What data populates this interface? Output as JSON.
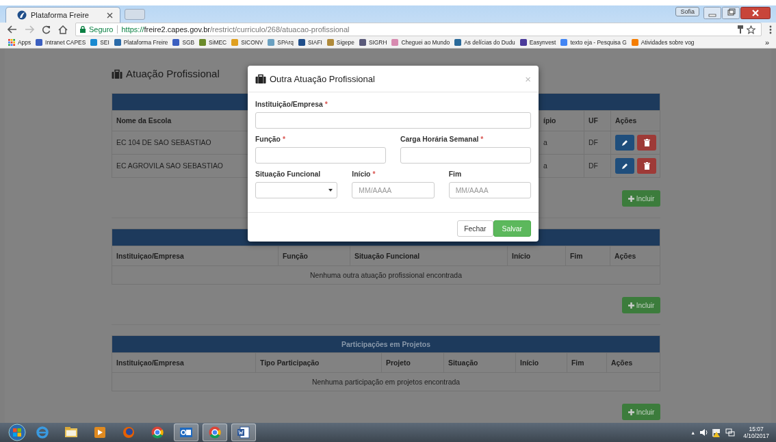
{
  "browser": {
    "tabs": [
      {
        "title": "Plataforma Freire",
        "selected": true
      }
    ],
    "user_button": "Sofia",
    "address": {
      "security": "Seguro",
      "scheme": "https://",
      "host": "freire2.capes.gov.br",
      "path": "/restrict/curriculo/268/atuacao-profissional"
    },
    "apps_label": "Apps",
    "bookmarks": [
      {
        "label": "Intranet CAPES",
        "color": "#3b5fc0"
      },
      {
        "label": "SEI",
        "color": "#1a8ad0"
      },
      {
        "label": "Plataforma Freire",
        "color": "#2a6aa8"
      },
      {
        "label": "SGB",
        "color": "#3b5fc0"
      },
      {
        "label": "SiMEC",
        "color": "#6a8a2a"
      },
      {
        "label": "SICONV",
        "color": "#e0a020"
      },
      {
        "label": "SPArq",
        "color": "#6aa0c0"
      },
      {
        "label": "SIAFI",
        "color": "#1f4e8a"
      },
      {
        "label": "Sigepe",
        "color": "#b08a3a"
      },
      {
        "label": "SIGRH",
        "color": "#5a5a7a"
      },
      {
        "label": "Cheguei ao Mundo",
        "color": "#d88ab0"
      },
      {
        "label": "As delícias do Dudu",
        "color": "#2a6a9a"
      },
      {
        "label": "Easynvest",
        "color": "#4a3a9a"
      },
      {
        "label": "texto eja - Pesquisa G",
        "color": "#4285f4"
      },
      {
        "label": "Atividades sobre vog",
        "color": "#f57d00"
      }
    ],
    "more": "»"
  },
  "page": {
    "heading": "Atuação Profissional",
    "sections": [
      {
        "columns": [
          "Nome da Escola",
          "ípio",
          "UF",
          "Ações"
        ],
        "rows": [
          {
            "cells": [
              "EC 104 DE SAO SEBASTIAO",
              "a",
              "DF"
            ],
            "actions": [
              {
                "kind": "edit"
              },
              {
                "kind": "delete"
              }
            ]
          },
          {
            "cells": [
              "EC AGROVILA SAO SEBASTIAO",
              "a",
              "DF"
            ],
            "actions": [
              {
                "kind": "edit"
              },
              {
                "kind": "delete"
              }
            ]
          }
        ],
        "button": "Incluir"
      },
      {
        "columns": [
          "Instituiçao/Empresa",
          "Função",
          "Situação Funcional",
          "Início",
          "Fim",
          "Ações"
        ],
        "empty_message": "Nenhuma outra atuação profissional encontrada",
        "button": "Incluir"
      },
      {
        "title": "Participações em Projetos",
        "columns": [
          "Instituiçao/Empresa",
          "Tipo Participação",
          "Projeto",
          "Situação",
          "Início",
          "Fim",
          "Ações"
        ],
        "empty_message": "Nenhuma participação em projetos encontrada",
        "button": "Incluir"
      }
    ]
  },
  "modal": {
    "title": "Outra Atuação Profissional",
    "close": "×",
    "field_rows": [
      [
        {
          "label": "Instituição/Empresa",
          "required_mark": "*",
          "kind": "text"
        }
      ],
      [
        {
          "label": "Função",
          "required_mark": "*",
          "kind": "text"
        },
        {
          "label": "Carga Horária Semanal",
          "required_mark": "*",
          "kind": "text"
        }
      ],
      [
        {
          "label": "Situação Funcional",
          "kind": "select"
        },
        {
          "label": "Início",
          "required_mark": "*",
          "kind": "text",
          "placeholder": "MM/AAAA"
        },
        {
          "label": "Fim",
          "kind": "text",
          "placeholder": "MM/AAAA"
        }
      ]
    ],
    "buttons": [
      {
        "label": "Fechar",
        "kind": "default"
      },
      {
        "label": "Salvar",
        "kind": "primary"
      }
    ]
  },
  "taskbar": {
    "apps": [
      {
        "kind": "ie",
        "active": false
      },
      {
        "kind": "folder",
        "active": false
      },
      {
        "kind": "media",
        "active": false
      },
      {
        "kind": "firefox",
        "active": false
      },
      {
        "kind": "chrome",
        "active": false
      },
      {
        "kind": "outlook",
        "active": true
      },
      {
        "kind": "chrome",
        "active": true
      },
      {
        "kind": "word",
        "active": true
      }
    ],
    "tray_arrow": "▲",
    "time": "15:07",
    "date": "4/10/2017"
  }
}
